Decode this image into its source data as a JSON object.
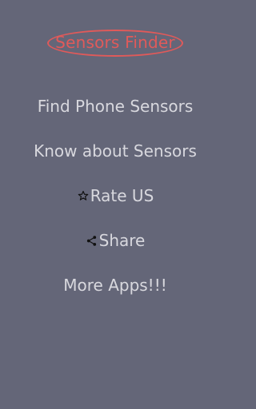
{
  "app": {
    "title": "Sensors Finder"
  },
  "menu": {
    "items": [
      {
        "label": "Find Phone Sensors",
        "icon": ""
      },
      {
        "label": "Know about Sensors",
        "icon": ""
      },
      {
        "label": "Rate US",
        "icon": "star-outline-icon"
      },
      {
        "label": "Share",
        "icon": "share-icon"
      },
      {
        "label": "More Apps!!!",
        "icon": ""
      }
    ]
  },
  "colors": {
    "background": "#646678",
    "title": "#e05a5a",
    "menu_text": "#d8d8de",
    "icon": "#111111"
  }
}
